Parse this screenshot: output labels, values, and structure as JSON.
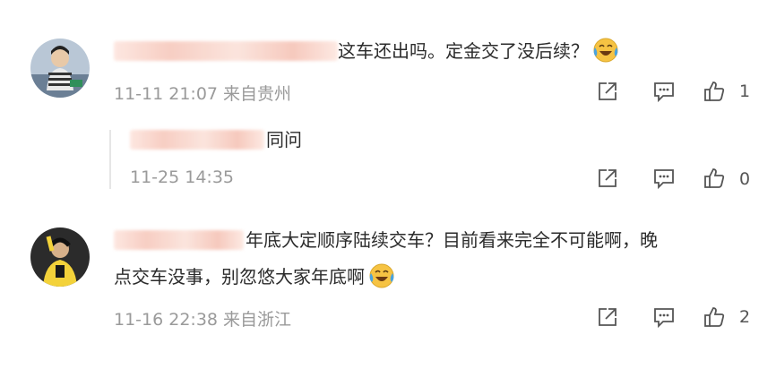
{
  "comments": [
    {
      "text": "这车还出吗。定金交了没后续？",
      "emoji": "crying-laughing-emoji",
      "meta": "11-11 21:07 来自贵州",
      "likes": "1"
    },
    {
      "text": "同问",
      "meta": "11-25 14:35",
      "likes": "0"
    },
    {
      "text_line1": "年底大定顺序陆续交车？目前看来完全不可能啊，晚",
      "text_line2": "点交车没事，别忽悠大家年底啊",
      "emoji": "crying-laughing-emoji",
      "meta": "11-16 22:38 来自浙江",
      "likes": "2"
    }
  ],
  "colors": {
    "meta_text": "#9a9a9a",
    "icon_stroke": "#555555",
    "emoji_yellow": "#f6c343",
    "emoji_tear": "#4aa3df"
  }
}
